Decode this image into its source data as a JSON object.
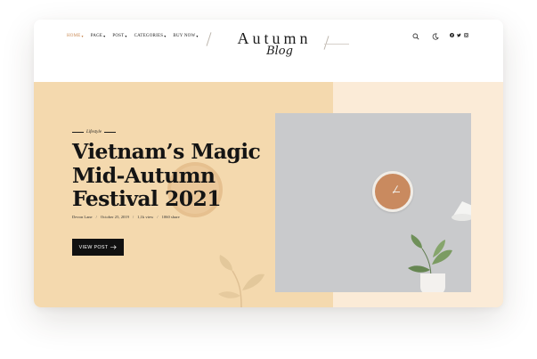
{
  "header": {
    "nav": [
      {
        "label": "HOME",
        "active": true
      },
      {
        "label": "PAGE",
        "active": false
      },
      {
        "label": "POST",
        "active": false
      },
      {
        "label": "CATEGORIES",
        "active": false
      },
      {
        "label": "BUY NOW",
        "active": false
      }
    ],
    "logo_main": "Autumn",
    "logo_script": "Blog",
    "icons": [
      "search-icon",
      "moon-icon"
    ],
    "social_icons": [
      "facebook-icon",
      "twitter-icon",
      "instagram-icon"
    ]
  },
  "hero": {
    "category": "Lifestyle",
    "title_lines": [
      "Vietnam’s Magic",
      "Mid-Autumn",
      "Festival 2021"
    ],
    "meta": {
      "author": "Devon Lane",
      "date": "October 25, 2019",
      "views": "1,1k view",
      "shares": "1060 share"
    },
    "button_label": "VIEW POST",
    "colors": {
      "accent": "#c8864f",
      "hero_bg": "#f4d9ae",
      "button_bg": "#111111"
    }
  }
}
